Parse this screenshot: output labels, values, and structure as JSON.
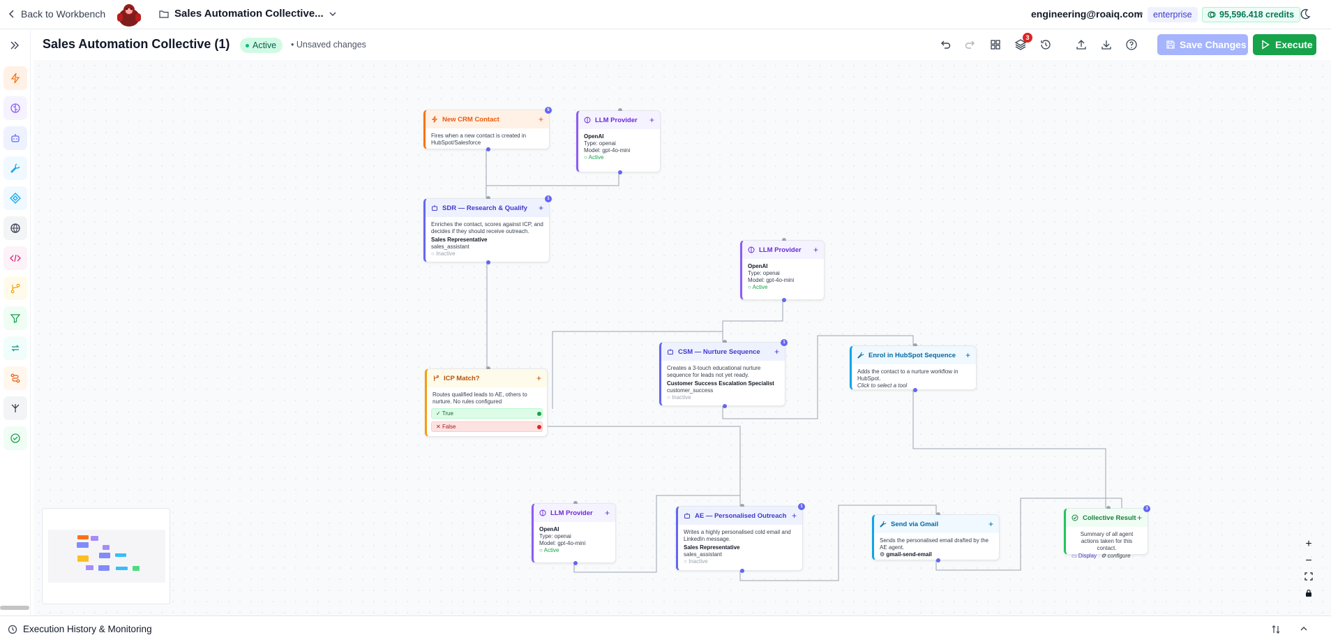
{
  "topbar": {
    "back_label": "Back to Workbench",
    "project_name": "Sales Automation Collective...",
    "user_email": "engineering@roaiq.com",
    "tier": "enterprise",
    "credits": "95,596.418 credits"
  },
  "toolbar": {
    "workflow_title": "Sales Automation Collective (1)",
    "status": "Active",
    "unsaved": "Unsaved changes",
    "layers_badge": "3",
    "save_label": "Save Changes",
    "execute_label": "Execute"
  },
  "sidebar_tools": [
    {
      "icon": "bolt-icon",
      "color": "#f97316"
    },
    {
      "icon": "brain-icon",
      "color": "#8b5cf6"
    },
    {
      "icon": "bot-icon",
      "color": "#6366f1"
    },
    {
      "icon": "wrench-icon",
      "color": "#0ea5e9"
    },
    {
      "icon": "diamond-icon",
      "color": "#0ea5e9"
    },
    {
      "icon": "globe-icon",
      "color": "#374151"
    },
    {
      "icon": "code-icon",
      "color": "#db2777"
    },
    {
      "icon": "branch-icon",
      "color": "#f59e0b"
    },
    {
      "icon": "filter-icon",
      "color": "#16a34a"
    },
    {
      "icon": "loop-icon",
      "color": "#0d9488"
    },
    {
      "icon": "route-icon",
      "color": "#ea580c"
    },
    {
      "icon": "merge-icon",
      "color": "#374151"
    },
    {
      "icon": "check-circle-icon",
      "color": "#16a34a"
    }
  ],
  "nodes": {
    "crm": {
      "title": "New CRM Contact",
      "badge": "5",
      "desc": "Fires when a new contact is created in HubSpot/Salesforce"
    },
    "llm1": {
      "title": "LLM Provider",
      "provider": "OpenAI",
      "type": "Type: openai",
      "model": "Model: gpt-4o-mini",
      "status": "Active"
    },
    "sdr": {
      "title": "SDR — Research & Qualify",
      "badge": "1",
      "desc": "Enriches the contact, scores against ICP, and decides if they should receive outreach.",
      "role": "Sales Representative",
      "role_id": "sales_assistant",
      "status": "Inactive"
    },
    "llm2": {
      "title": "LLM Provider",
      "provider": "OpenAI",
      "type": "Type: openai",
      "model": "Model: gpt-4o-mini",
      "status": "Active"
    },
    "icp": {
      "title": "ICP Match?",
      "desc": "Routes qualified leads to AE, others to nurture. No rules configured",
      "true_label": "True",
      "false_label": "False"
    },
    "csm": {
      "title": "CSM — Nurture Sequence",
      "badge": "1",
      "desc": "Creates a 3-touch educational nurture sequence for leads not yet ready.",
      "role": "Customer Success Escalation Specialist",
      "role_id": "customer_success",
      "status": "Inactive"
    },
    "hubspot": {
      "title": "Enrol in HubSpot Sequence",
      "desc": "Adds the contact to a nurture workflow in HubSpot.",
      "hint": "Click to select a tool"
    },
    "llm3": {
      "title": "LLM Provider",
      "provider": "OpenAI",
      "type": "Type: openai",
      "model": "Model: gpt-4o-mini",
      "status": "Active"
    },
    "ae": {
      "title": "AE — Personalised Outreach",
      "badge": "1",
      "desc": "Writes a highly personalised cold email and LinkedIn message.",
      "role": "Sales Representative",
      "role_id": "sales_assistant",
      "status": "Inactive"
    },
    "gmail": {
      "title": "Send via Gmail",
      "desc": "Sends the personalised email drafted by the AE agent.",
      "tool": "gmail-send-email"
    },
    "result": {
      "title": "Collective Result",
      "badge": "3",
      "desc": "Summary of all agent actions taken for this contact.",
      "display": "Display",
      "configure": "configure"
    }
  },
  "bottom": {
    "title": "Execution History & Monitoring"
  }
}
